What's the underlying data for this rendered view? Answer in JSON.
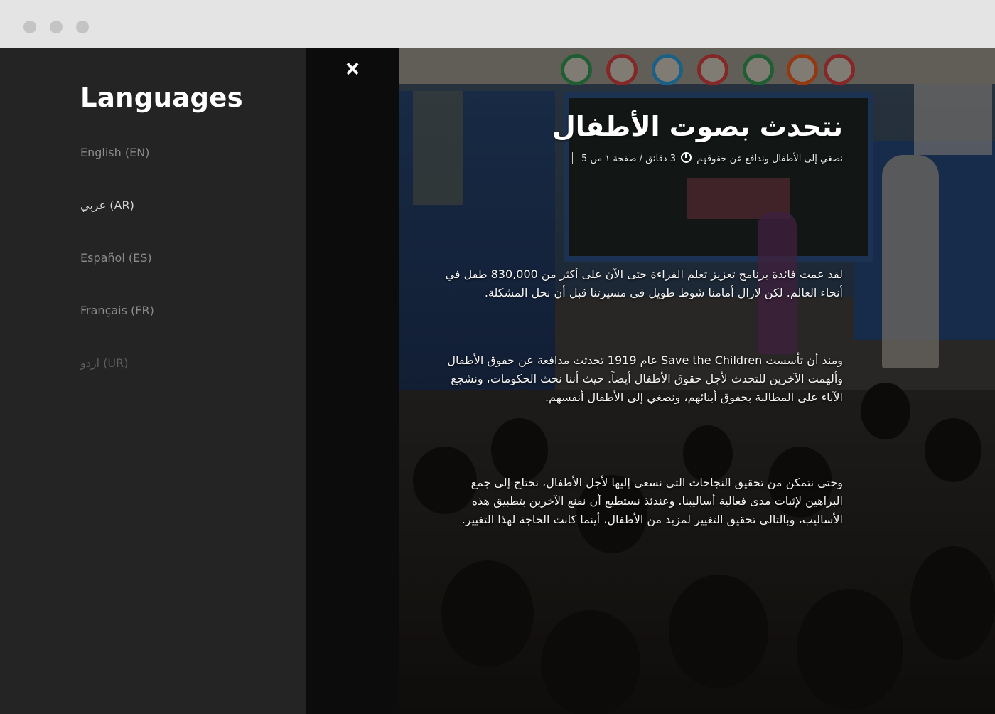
{
  "languages_panel": {
    "title": "Languages",
    "items": [
      {
        "label": "English (EN)"
      },
      {
        "label": "عربي (AR)"
      },
      {
        "label": "Español (ES)"
      },
      {
        "label": "Français (FR)"
      },
      {
        "label": "اردو (UR)"
      }
    ]
  },
  "close": {
    "label": "×"
  },
  "article": {
    "title": "نتحدث بصوت الأطفال",
    "meta": {
      "subtitle": "نصغي إلى الأطفال وندافع عن حقوقهم",
      "read_time": "3 دقائق / صفحة ١ من 5"
    },
    "paragraphs": [
      "لقد عمت فائدة برنامج تعزيز تعلم القراءة حتى الآن على أكثر من 830,000 طفل في أنحاء العالم. لكن لازال أمامنا شوط طويل في مسيرتنا قبل أن نحل المشكلة.",
      "ومنذ أن تأسست Save the Children عام 1919 تحدثت مدافعة عن حقوق الأطفال وألهمت الآخرين للتحدث لأجل حقوق الأطفال أيضاً. حيث أننا نحث الحكومات، ونشجع الآباء على المطالبة بحقوق أبنائهم، ونصغي إلى الأطفال أنفسهم.",
      "وحتى نتمكن من تحقيق النجاحات التي نسعى إليها لأجل الأطفال، نحتاج إلى جمع البراهين لإثبات مدى فعالية أساليبنا. وعندئذ نستطيع أن نقنع الآخرين بتطبيق هذه الأساليب، وبالتالي تحقيق التغيير لمزيد من الأطفال، أينما كانت الحاجة لهذا التغيير."
    ]
  }
}
